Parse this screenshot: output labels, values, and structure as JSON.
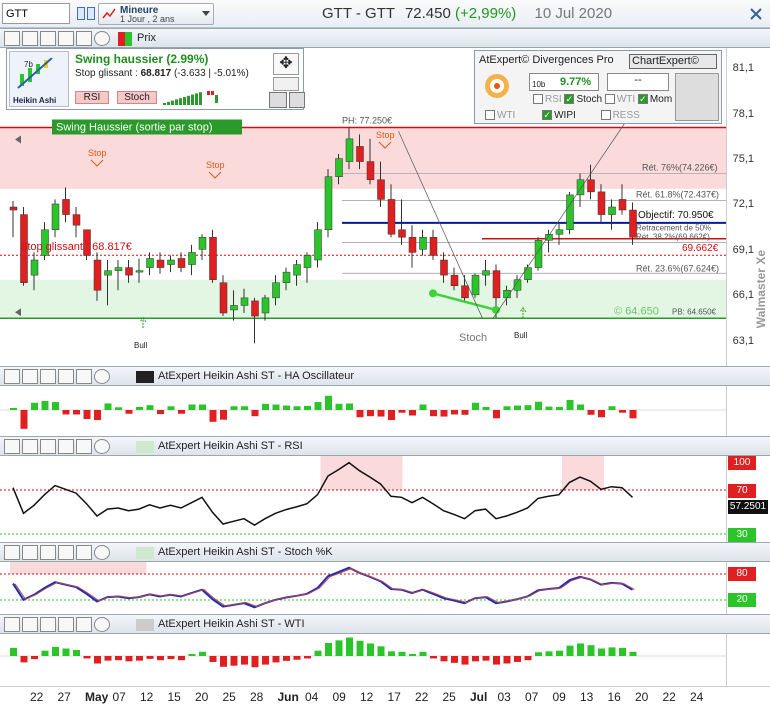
{
  "toolbar": {
    "symbol": "GTT",
    "period_line1": "Mineure",
    "period_line2": "1 Jour , 2 ans",
    "title": "GTT - GTT",
    "price": "72.450",
    "change": "(+2,99%)",
    "date": "10 Jul 2020"
  },
  "main_panel": {
    "label": "Prix",
    "signal_box": {
      "title": "Swing haussier (2.99%)",
      "stop_label": "Stop glissant :",
      "stop_value": "68.817",
      "stop_delta": "(-3.633 | -5.01%)",
      "btn_rsi": "RSI",
      "btn_stoch": "Stoch",
      "logo_top": "7b",
      "logo_bottom": "Heikin Ashi"
    },
    "divergence_box": {
      "title": "AtExpert© Divergences Pro",
      "chartexpert": "ChartExpert©",
      "percent": "9.77%",
      "bars": "10b",
      "dash": "--",
      "opt_rsi": "RSI",
      "opt_stoch": "Stoch",
      "opt_wti": "WTI",
      "opt_mom": "Mom",
      "opt_wti2": "WTI",
      "opt_wipi": "WIPI",
      "opt_ress": "RESS"
    },
    "banner": "Swing Haussier (sortie par stop)",
    "ph_label": "PH: 77.250€",
    "fib_76": "Rét. 76%(74.226€)",
    "fib_61": "Rét. 61.8%(72.437€)",
    "objectif": "Objectif: 70.950€",
    "fib_50": "Retracement de 50%",
    "fib_38": "Rét. 38.2%(69.662€)",
    "stop_price": "69.662€",
    "fib_23": "Rét. 23.6%(67.624€)",
    "stop_glissant": "Stop glissant : 68.817€",
    "support": "© 64.650",
    "pb_label": "PB: 64.650€",
    "stoch_label": "Stoch",
    "stop_marker": "Stop",
    "bull_marker": "Bull",
    "watermark": "Walmaster Xe",
    "y_ticks": [
      "81,1",
      "78,1",
      "75,1",
      "72,1",
      "69,1",
      "66,1",
      "63,1"
    ]
  },
  "panels": {
    "osc_title": "AtExpert Heikin Ashi ST - HA Oscillateur",
    "rsi_title": "AtExpert Heikin Ashi ST - RSI",
    "stoch_title": "AtExpert Heikin Ashi ST - Stoch %K",
    "wti_title": "AtExpert Heikin Ashi ST - WTI",
    "rsi_badges": [
      "100",
      "70",
      "57.2501",
      "30"
    ],
    "stoch_badges": [
      "80",
      "20"
    ]
  },
  "x_axis": [
    "22",
    "27",
    "May",
    "07",
    "12",
    "15",
    "20",
    "25",
    "28",
    "Jun",
    "04",
    "09",
    "12",
    "17",
    "22",
    "25",
    "Jul",
    "03",
    "07",
    "09",
    "13",
    "16",
    "20",
    "22",
    "24"
  ],
  "colors": {
    "up": "#2bc52b",
    "down": "#e02020",
    "banner": "#2a9a2a",
    "support": "#2a9a2a",
    "objectif": "#0a1a9a",
    "stop": "#d01010"
  },
  "chart_data": {
    "type": "candlestick",
    "title": "GTT - GTT",
    "ylabel": "",
    "ylim": [
      61.5,
      82.5
    ],
    "candles_ohlc_approx": [
      [
        72.0,
        72.4,
        70.0,
        71.8
      ],
      [
        71.5,
        72.0,
        66.8,
        67.0
      ],
      [
        67.5,
        69.0,
        66.5,
        68.5
      ],
      [
        68.8,
        71.0,
        68.5,
        70.5
      ],
      [
        70.5,
        72.5,
        70.0,
        72.2
      ],
      [
        72.5,
        73.3,
        71.0,
        71.5
      ],
      [
        71.5,
        72.0,
        70.0,
        70.8
      ],
      [
        70.5,
        70.5,
        68.5,
        68.8
      ],
      [
        68.5,
        69.0,
        65.8,
        66.5
      ],
      [
        67.5,
        68.5,
        65.5,
        67.8
      ],
      [
        67.8,
        68.5,
        66.5,
        68.0
      ],
      [
        68.0,
        68.5,
        67.0,
        67.5
      ],
      [
        67.8,
        68.6,
        67.0,
        67.8
      ],
      [
        68.0,
        69.0,
        67.5,
        68.6
      ],
      [
        68.5,
        69.0,
        67.6,
        68.0
      ],
      [
        68.2,
        68.8,
        67.7,
        68.5
      ],
      [
        68.6,
        69.0,
        67.7,
        68.0
      ],
      [
        68.2,
        69.5,
        67.5,
        69.0
      ],
      [
        69.2,
        70.2,
        68.5,
        70.0
      ],
      [
        70.0,
        70.5,
        67.0,
        67.2
      ],
      [
        67.0,
        67.5,
        64.8,
        65.0
      ],
      [
        65.2,
        66.5,
        64.5,
        65.5
      ],
      [
        65.5,
        66.6,
        65.0,
        66.0
      ],
      [
        65.8,
        66.0,
        63.0,
        64.8
      ],
      [
        65.0,
        66.2,
        64.5,
        66.0
      ],
      [
        66.0,
        67.5,
        65.5,
        67.0
      ],
      [
        67.0,
        68.0,
        66.5,
        67.7
      ],
      [
        67.5,
        68.5,
        66.8,
        68.2
      ],
      [
        68.0,
        69.0,
        67.0,
        68.8
      ],
      [
        68.5,
        71.0,
        68.0,
        70.5
      ],
      [
        70.5,
        74.5,
        70.0,
        74.0
      ],
      [
        74.0,
        75.5,
        73.5,
        75.2
      ],
      [
        75.0,
        77.3,
        74.5,
        76.5
      ],
      [
        76.0,
        76.8,
        74.5,
        75.0
      ],
      [
        75.0,
        76.5,
        73.5,
        73.8
      ],
      [
        73.8,
        75.0,
        72.0,
        72.5
      ],
      [
        72.5,
        73.5,
        70.0,
        70.2
      ],
      [
        70.5,
        72.5,
        69.5,
        70.0
      ],
      [
        70.0,
        70.8,
        68.0,
        69.0
      ],
      [
        69.2,
        70.5,
        68.8,
        70.0
      ],
      [
        70.0,
        70.5,
        68.5,
        68.8
      ],
      [
        68.5,
        69.0,
        67.0,
        67.5
      ],
      [
        67.5,
        68.0,
        66.5,
        66.8
      ],
      [
        66.8,
        67.5,
        65.8,
        66.0
      ],
      [
        66.2,
        67.6,
        66.0,
        67.5
      ],
      [
        67.5,
        68.5,
        66.8,
        67.8
      ],
      [
        67.8,
        68.2,
        64.7,
        66.0
      ],
      [
        66.0,
        66.8,
        65.5,
        66.5
      ],
      [
        66.5,
        67.5,
        66.0,
        67.2
      ],
      [
        67.2,
        68.2,
        67.0,
        68.0
      ],
      [
        68.0,
        70.0,
        67.8,
        69.8
      ],
      [
        69.8,
        70.5,
        69.0,
        70.2
      ],
      [
        70.2,
        71.0,
        69.5,
        70.5
      ],
      [
        70.5,
        73.0,
        70.2,
        72.8
      ],
      [
        72.8,
        74.2,
        72.0,
        73.8
      ],
      [
        73.8,
        74.8,
        72.5,
        73.0
      ],
      [
        73.0,
        73.5,
        71.0,
        71.5
      ],
      [
        71.5,
        72.5,
        70.5,
        72.0
      ],
      [
        72.5,
        73.5,
        71.5,
        71.8
      ],
      [
        71.8,
        72.3,
        69.5,
        70.0
      ]
    ],
    "levels": {
      "ph": 77.25,
      "fib76": 74.226,
      "fib618": 72.437,
      "objectif": 70.95,
      "fib382": 69.662,
      "stop_glissant": 68.817,
      "fib236": 67.624,
      "support": 64.65
    }
  }
}
